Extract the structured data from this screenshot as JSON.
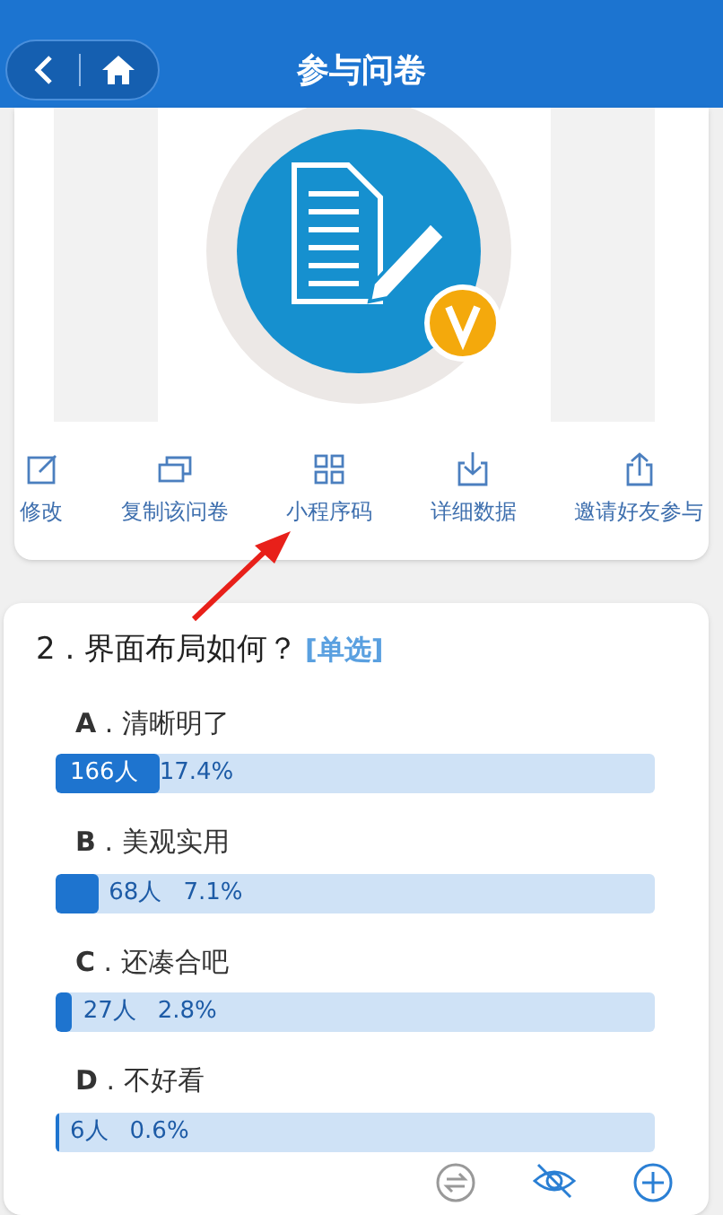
{
  "header": {
    "title": "参与问卷"
  },
  "actions": [
    {
      "kind": "edit",
      "label": "修改"
    },
    {
      "kind": "copy",
      "label": "复制该问卷"
    },
    {
      "kind": "qrcode",
      "label": "小程序码"
    },
    {
      "kind": "download",
      "label": "详细数据"
    },
    {
      "kind": "share",
      "label": "邀请好友参与"
    }
  ],
  "question": {
    "number": "2",
    "separator": ".",
    "text": "界面布局如何？",
    "type_tag": "[单选]",
    "options": [
      {
        "letter": "A",
        "separator": ".",
        "text": "清晰明了",
        "count": "166人",
        "percent": "17.4%",
        "level": 0.174
      },
      {
        "letter": "B",
        "separator": ".",
        "text": "美观实用",
        "count": "68人",
        "percent": "7.1%",
        "level": 0.071
      },
      {
        "letter": "C",
        "separator": ".",
        "text": "还凑合吧",
        "count": "27人",
        "percent": "2.8%",
        "level": 0.028
      },
      {
        "letter": "D",
        "separator": ".",
        "text": "不好看",
        "count": "6人",
        "percent": "0.6%",
        "level": 0.006
      }
    ]
  }
}
